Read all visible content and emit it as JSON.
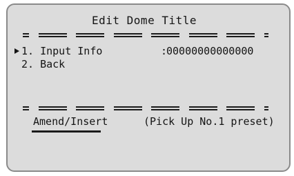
{
  "screen": {
    "title": "Edit Dome Title",
    "menu": {
      "items": [
        {
          "label": "1. Input Info",
          "separator": ":",
          "value": "00000000000000",
          "selected": true
        },
        {
          "label": "2. Back",
          "selected": false
        }
      ]
    },
    "footer": {
      "action_label": "Amend/Insert",
      "hint": "(Pick Up No.1 preset)"
    },
    "cursor_icon": "right-triangle-cursor"
  }
}
